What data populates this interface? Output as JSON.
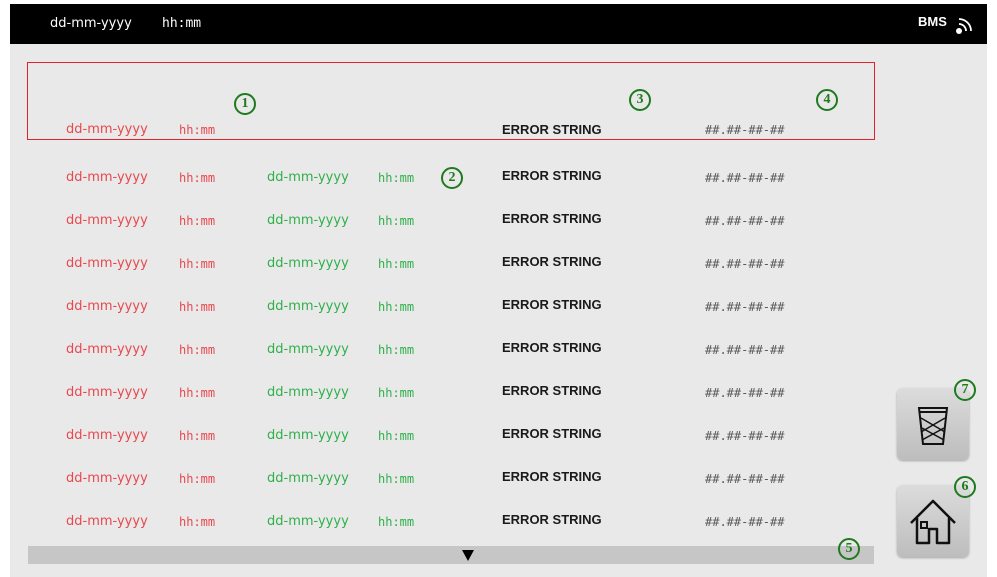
{
  "header": {
    "date": "dd-mm-yyyy",
    "time": "hh:mm",
    "status_label": "BMS",
    "signal_icon": "wifi-signal-icon"
  },
  "selected_entry": {
    "date": "dd-mm-yyyy",
    "time": "hh:mm",
    "error": "ERROR STRING",
    "code": "##.##-##-##"
  },
  "log_rows": [
    {
      "date1": "dd-mm-yyyy",
      "time1": "hh:mm",
      "date2": "dd-mm-yyyy",
      "time2": "hh:mm",
      "error": "ERROR STRING",
      "code": "##.##-##-##"
    },
    {
      "date1": "dd-mm-yyyy",
      "time1": "hh:mm",
      "date2": "dd-mm-yyyy",
      "time2": "hh:mm",
      "error": "ERROR STRING",
      "code": "##.##-##-##"
    },
    {
      "date1": "dd-mm-yyyy",
      "time1": "hh:mm",
      "date2": "dd-mm-yyyy",
      "time2": "hh:mm",
      "error": "ERROR STRING",
      "code": "##.##-##-##"
    },
    {
      "date1": "dd-mm-yyyy",
      "time1": "hh:mm",
      "date2": "dd-mm-yyyy",
      "time2": "hh:mm",
      "error": "ERROR STRING",
      "code": "##.##-##-##"
    },
    {
      "date1": "dd-mm-yyyy",
      "time1": "hh:mm",
      "date2": "dd-mm-yyyy",
      "time2": "hh:mm",
      "error": "ERROR STRING",
      "code": "##.##-##-##"
    },
    {
      "date1": "dd-mm-yyyy",
      "time1": "hh:mm",
      "date2": "dd-mm-yyyy",
      "time2": "hh:mm",
      "error": "ERROR STRING",
      "code": "##.##-##-##"
    },
    {
      "date1": "dd-mm-yyyy",
      "time1": "hh:mm",
      "date2": "dd-mm-yyyy",
      "time2": "hh:mm",
      "error": "ERROR STRING",
      "code": "##.##-##-##"
    },
    {
      "date1": "dd-mm-yyyy",
      "time1": "hh:mm",
      "date2": "dd-mm-yyyy",
      "time2": "hh:mm",
      "error": "ERROR STRING",
      "code": "##.##-##-##"
    },
    {
      "date1": "dd-mm-yyyy",
      "time1": "hh:mm",
      "date2": "dd-mm-yyyy",
      "time2": "hh:mm",
      "error": "ERROR STRING",
      "code": "##.##-##-##"
    }
  ],
  "annotations": [
    "1",
    "2",
    "3",
    "4",
    "5",
    "6",
    "7"
  ],
  "buttons": {
    "trash_icon": "trash-icon",
    "home_icon": "home-icon",
    "scroll_icon": "scroll-down-icon"
  },
  "colors": {
    "start_date": "#e8484e",
    "end_date": "#2fb04a",
    "selection_border": "#e0242e",
    "annotation": "#1f7a1f"
  }
}
